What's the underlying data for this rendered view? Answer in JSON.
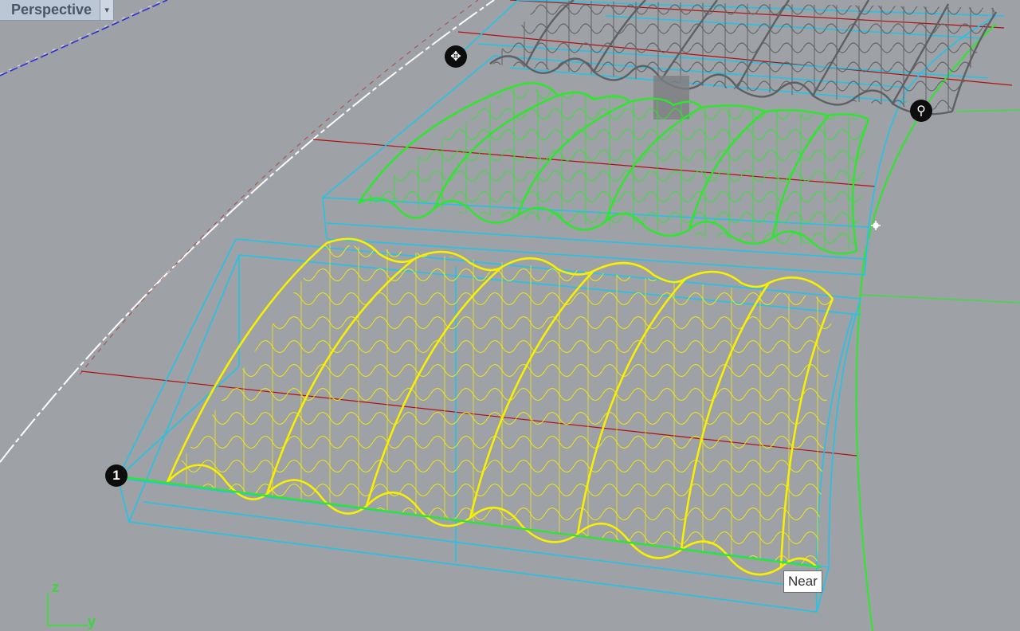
{
  "viewport": {
    "title": "Perspective",
    "dropdown_glyph": "▾"
  },
  "tooltip": {
    "text": "Near"
  },
  "markers": {
    "one": "1",
    "two": "✥",
    "three": "⚲"
  },
  "axes": {
    "z": "z",
    "y": "y"
  },
  "colors": {
    "background": "#9ea1a5",
    "bounding_boxes": "#22c3e6",
    "yellow_structure": "#f7f000",
    "green_structure": "#2be82b",
    "gray_structure": "#5e6063",
    "red_grid": "#b01010"
  }
}
